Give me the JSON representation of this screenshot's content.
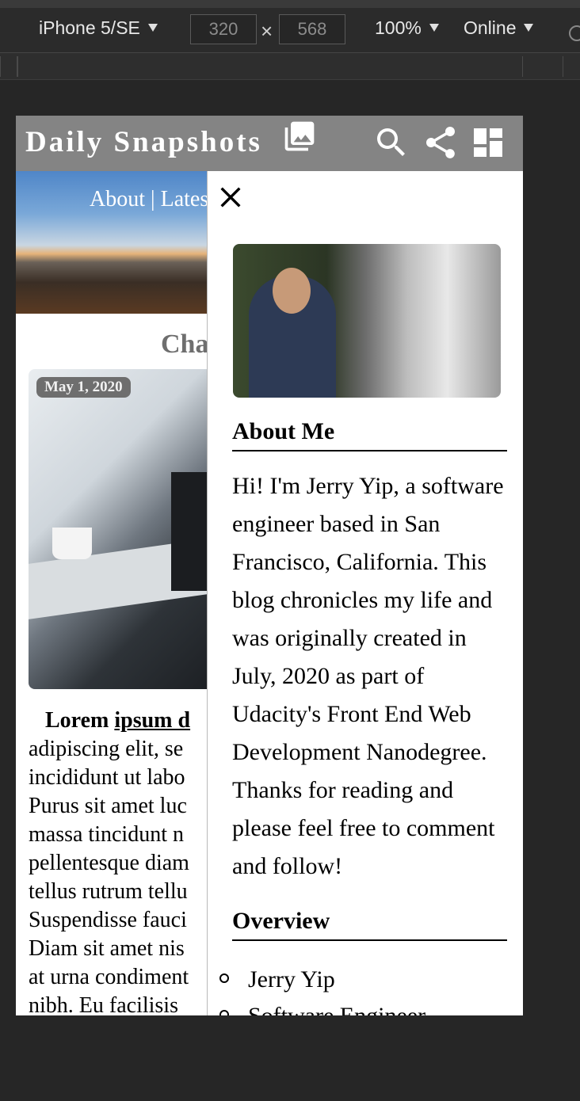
{
  "devtools": {
    "device": "iPhone 5/SE",
    "width": "320",
    "height": "568",
    "times": "×",
    "zoom": "100%",
    "network": "Online"
  },
  "site": {
    "title": "Daily Snapshots",
    "icons": [
      "photo-library-icon",
      "search-icon",
      "share-icon",
      "dashboard-icon"
    ]
  },
  "hero": {
    "nav": "About | Lates"
  },
  "post": {
    "title": "Cha",
    "date": "May 1, 2020",
    "lead_bold": "Lorem",
    "lead_link": "ipsum d",
    "lines": [
      "adipiscing elit, se",
      "incididunt ut labo",
      "Purus sit amet luc",
      "massa tincidunt n",
      "pellentesque diam",
      "tellus rutrum tellu",
      "Suspendisse fauci",
      "Diam sit amet nis",
      "at urna condiment",
      "nibh. Eu facilisis"
    ]
  },
  "drawer": {
    "close_icon": "close-icon",
    "about_heading": "About Me",
    "about_lines": [
      "Hi! I'm Jerry Yip, a software",
      "engineer based in San",
      "Francisco, California. This",
      "blog chronicles my life and",
      "was originally created in",
      "July, 2020 as part of",
      "Udacity's Front End Web",
      "Development Nanodegree.",
      "Thanks for reading and",
      "please feel free to comment",
      "and follow!"
    ],
    "overview_heading": "Overview",
    "overview_items": [
      "Jerry Yip",
      "Software Engineer"
    ]
  }
}
